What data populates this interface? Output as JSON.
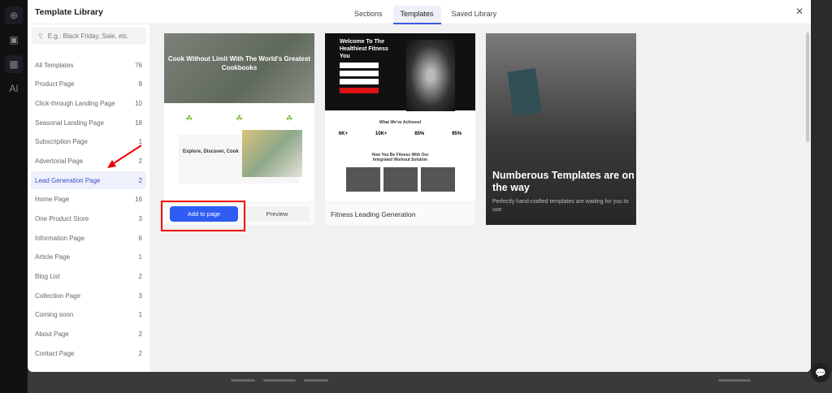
{
  "modal": {
    "title": "Template Library",
    "tabs": [
      {
        "label": "Sections"
      },
      {
        "label": "Templates",
        "active": true
      },
      {
        "label": "Saved Library"
      }
    ]
  },
  "search": {
    "placeholder": "E.g.: Black Friday, Sale, etc."
  },
  "categories": [
    {
      "label": "All Templates",
      "count": "76"
    },
    {
      "label": "Product Page",
      "count": "8"
    },
    {
      "label": "Click-through Landing Page",
      "count": "10"
    },
    {
      "label": "Seasonal Landing Page",
      "count": "18"
    },
    {
      "label": "Subscription Page",
      "count": "1"
    },
    {
      "label": "Advertorial Page",
      "count": "2"
    },
    {
      "label": "Lead Generation Page",
      "count": "2",
      "active": true
    },
    {
      "label": "Home Page",
      "count": "16"
    },
    {
      "label": "One Product Store",
      "count": "3"
    },
    {
      "label": "Information Page",
      "count": "6"
    },
    {
      "label": "Article Page",
      "count": "1"
    },
    {
      "label": "Blog List",
      "count": "2"
    },
    {
      "label": "Collection Page",
      "count": "3"
    },
    {
      "label": "Coming soon",
      "count": "1"
    },
    {
      "label": "About Page",
      "count": "2"
    },
    {
      "label": "Contact Page",
      "count": "2"
    }
  ],
  "cards": {
    "cook": {
      "hero": "Cook Without Limit With The World's Greatest Cookbooks",
      "section": "Explore, Discover, Cook",
      "add_label": "Add to page",
      "preview_label": "Preview"
    },
    "fitness": {
      "hero": "Welcome To The Healthiest Fitness You",
      "achieved": "What We've Achieved",
      "stats": [
        "6K+",
        "10K+",
        "85%",
        "95%"
      ],
      "solution": "How You Be Fitness With Our Integrated Workout Solution",
      "name": "Fitness Leading Generation"
    },
    "coming": {
      "title": "Numberous Templates are on the way",
      "subtitle": "Perfectly hand-crafted templates are waiting for you to use"
    }
  },
  "colors": {
    "accent": "#2f5cf2",
    "highlight": "#e00000"
  }
}
